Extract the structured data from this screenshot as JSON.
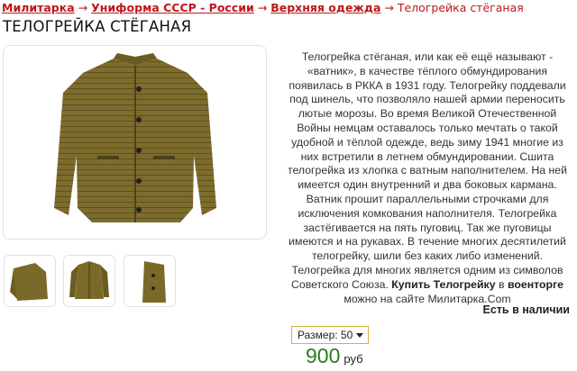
{
  "breadcrumb": {
    "items": [
      "Милитарка",
      "Униформа СССР - России",
      "Верхняя одежда"
    ],
    "current": "Телогрейка стёганая",
    "separator": "→"
  },
  "product": {
    "title": "ТЕЛОГРЕЙКА СТЁГАНАЯ",
    "description_main": "Телогрейка стёганая, или как её ещё называют - «ватник», в качестве тёплого обмундирования появилась в РККА в 1931 году. Телогрейку поддевали под шинель, что позволяло нашей армии переносить лютые морозы. Во время Великой Отечественной Войны немцам оставалось только мечтать о такой удобной и тёплой одежде, ведь зиму 1941 многие из них встретили в летнем обмундировании.  Сшита телогрейка из хлопка с ватным наполнителем. На ней имеется один внутренний и два боковых кармана. Ватник прошит параллельными строчками для исключения комкования  наполнителя.  Телогрейка застёгивается на пять пуговиц. Так же пуговицы имеются и на рукавах. В течение многих десятилетий телогрейку, шили без каких либо изменений. Телогрейка для многих является одним из символов Советского Союза.",
    "description_link": "Купить Телогрейку",
    "description_mid": "в",
    "description_link2": "военторге",
    "description_end": "можно на сайте Милитарка.Com",
    "stock": "Есть в наличии",
    "size_label": "Размер: 50",
    "price": "900",
    "currency": "руб"
  },
  "colors": {
    "link_red": "#c0171b",
    "price_green": "#2d7a1f",
    "jacket_olive": "#7a6a2a"
  }
}
